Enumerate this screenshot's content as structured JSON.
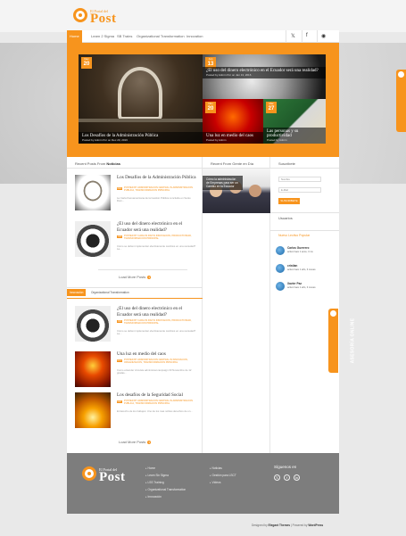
{
  "site": {
    "logo_pre": "El Portal del",
    "logo_main": "Post"
  },
  "nav": {
    "items": [
      "Home",
      "Learn 2 Sigma",
      "SB Trains",
      "Organizational Transformation",
      "Innovation"
    ],
    "social": [
      "𝕏",
      "f",
      "◉"
    ]
  },
  "slider": {
    "big": {
      "month": "Dec",
      "day": "20",
      "title": "Los Desafíos de la Administración Pública",
      "meta": "Posted by Admin Por on Dec 20, 2016"
    },
    "t1": {
      "month": "Jun",
      "day": "13",
      "title": "¿El uso del dinero electrónico en el Ecuador será una realidad?",
      "meta": "Posted by Admin Por on Jan 13, 2016"
    },
    "t2": {
      "month": "Nov",
      "day": "20",
      "title": "Una luz en medio del caos",
      "meta": "Posted by Admin"
    },
    "t3": {
      "month": "Mar",
      "day": "27",
      "title": "Las personas y su productividad",
      "meta": "Posted by Admin"
    }
  },
  "recent": {
    "heading_pre": "Recent Posts From",
    "heading_cat": "Noticias",
    "posts": [
      {
        "title": "Los Desafíos de la Administración Pública",
        "cat": "DEC 20",
        "meta": "POSTED BY ADMINISTRACION CENTRAL IN ADMINISTRACION PUBLICA, TRANSFORMACION PRINCIPAL",
        "excerpt": "La Carta Iberoamericana de la Gestión Pública concluida en Santo Dom..."
      },
      {
        "title": "¿El uso del dinero electrónico en el Ecuador será una realidad?",
        "cat": "JUN 13",
        "meta": "POSTED BY CARLOS PAZ IN INNOVACION, PRODUCTIVIDAD, TRANSFORMACION PRINCIPAL",
        "excerpt": "Cómo se deben implementar efectivamente cambios en una sociedad? La..."
      }
    ],
    "load_more": "Load More Posts"
  },
  "tabs": {
    "items": [
      "Innovación",
      "Organizational Transformation"
    ],
    "posts": [
      {
        "title": "¿El uso del dinero electrónico en el Ecuador será una realidad?",
        "cat": "JUN 13",
        "meta": "POSTED BY CARLOS PAZ IN INNOVACION, PRODUCTIVIDAD, TRANSFORMACION PRINCIPAL",
        "excerpt": "Cómo se deben implementar efectivamente cambios en una sociedad? La..."
      },
      {
        "title": "Una luz en medio del caos",
        "cat": "NOV 20",
        "meta": "POSTED BY ADMINISTRACION CENTRAL IN INNOVACION, ORGANIZACION, TRANSFORMACION PRINCIPAL",
        "excerpt": "Como entender circuiste adminisnat campaign 30 Noviembre de 12 gradas..."
      },
      {
        "title": "Los desafíos de la Seguridad Social",
        "cat": "MAY 20",
        "meta": "POSTED BY ADMINISTRACION CENTRAL IN ADMINISTRACION PUBLICA, TRANSFORMACION PRINCIPAL",
        "excerpt": "El derecho de los trabajos: Uno de los mas nobles derechos de un..."
      }
    ],
    "load_more": "Load More Posts"
  },
  "gente": {
    "heading": "Recent From Gente en Día",
    "caption": "Cómo la administración de Empresas para ser un Cambio en la Ecuador"
  },
  "subscribe": {
    "heading": "Suscribete",
    "name_placeholder": "Nombre",
    "email_placeholder": "E-Mail",
    "button": "SUSCRIBETE"
  },
  "users": {
    "heading": "Usuarios",
    "tabs": "Nuevo  Lectivo  Popular",
    "members": [
      {
        "name": "Carlos Guerrero",
        "status": "active hace 1 anos, 3 ms"
      },
      {
        "name": "cristian",
        "status": "active hace 1 año, 3 meses"
      },
      {
        "name": "Xavier Paz",
        "status": "active hace 1 año, 3 meses"
      }
    ]
  },
  "side_tabs": {
    "label": "ASESORÍA ONLINE"
  },
  "footer": {
    "logo_pre": "El Portal del",
    "logo_main": "Post",
    "col1": [
      "Home",
      "Learn Six Sigma",
      "LSS Training",
      "Organizational Transformation",
      "Innovación"
    ],
    "col2": [
      "Noticias",
      "Gestión para LSCT",
      "Vídeos"
    ],
    "follow": "Síguenos en",
    "social": [
      "𝕏",
      "f",
      "in"
    ]
  },
  "credit": {
    "designed": "Designed by",
    "elegant": "Elegant Themes",
    "powered": "| Powered by",
    "wp": "WordPress"
  },
  "colors": {
    "accent": "#f7941d",
    "footer": "#7d7d7d",
    "background": "#e9e9e9"
  }
}
